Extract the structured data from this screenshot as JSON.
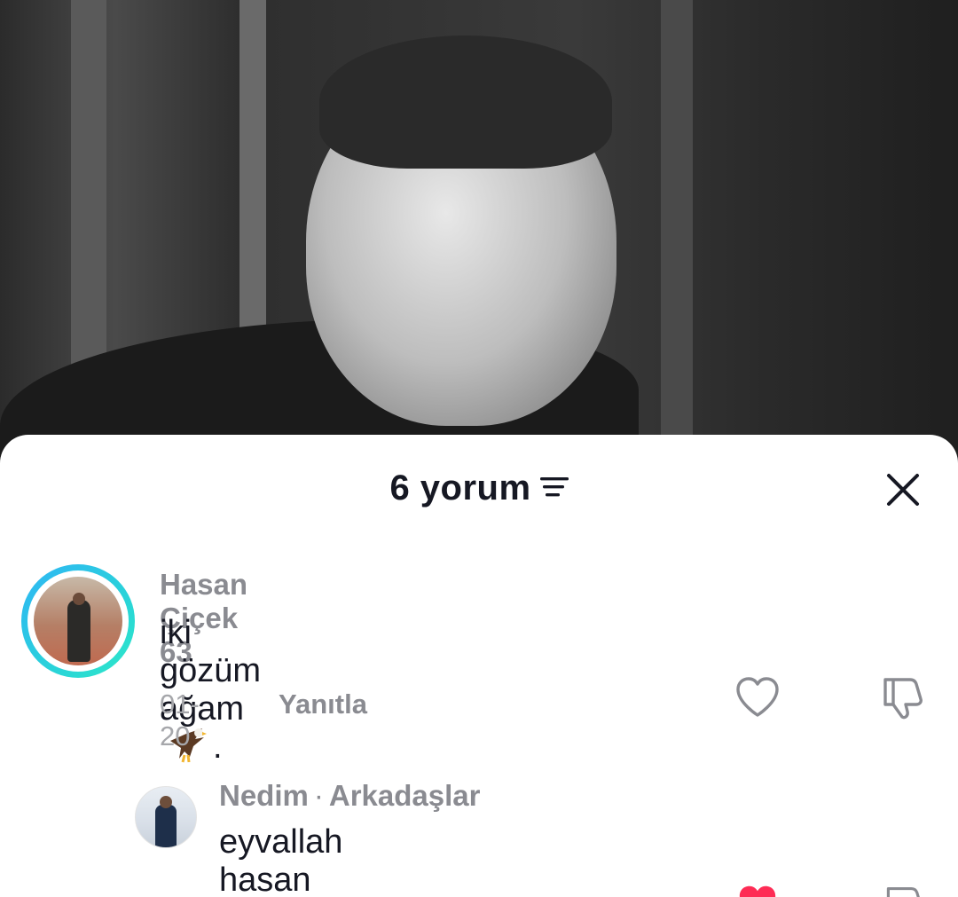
{
  "sheet": {
    "title": "6 yorum",
    "sort_icon": "sort-lines-icon",
    "close_icon": "close-icon"
  },
  "comments": [
    {
      "author": "Hasan Çiçek 63",
      "text": "iki gözüm ağam",
      "text_suffix": ".",
      "emoji": "eagle-emoji",
      "date": "01-20",
      "reply_label": "Yanıtla",
      "like_icon": "heart-outline-icon",
      "dislike_icon": "thumbs-down-icon",
      "avatar_ring_color": "#2fb5f5"
    },
    {
      "author": "Nedim",
      "separator": "·",
      "relation": "Arkadaşlar",
      "text": "eyvallah hasan abe",
      "like_icon": "heart-filled-icon",
      "like_color": "#fe2c55",
      "dislike_icon": "thumbs-down-icon"
    }
  ],
  "colors": {
    "title_text": "#161823",
    "secondary_text": "#8a8b91",
    "meta_text": "#a6a7ab",
    "like_active": "#fe2c55"
  }
}
